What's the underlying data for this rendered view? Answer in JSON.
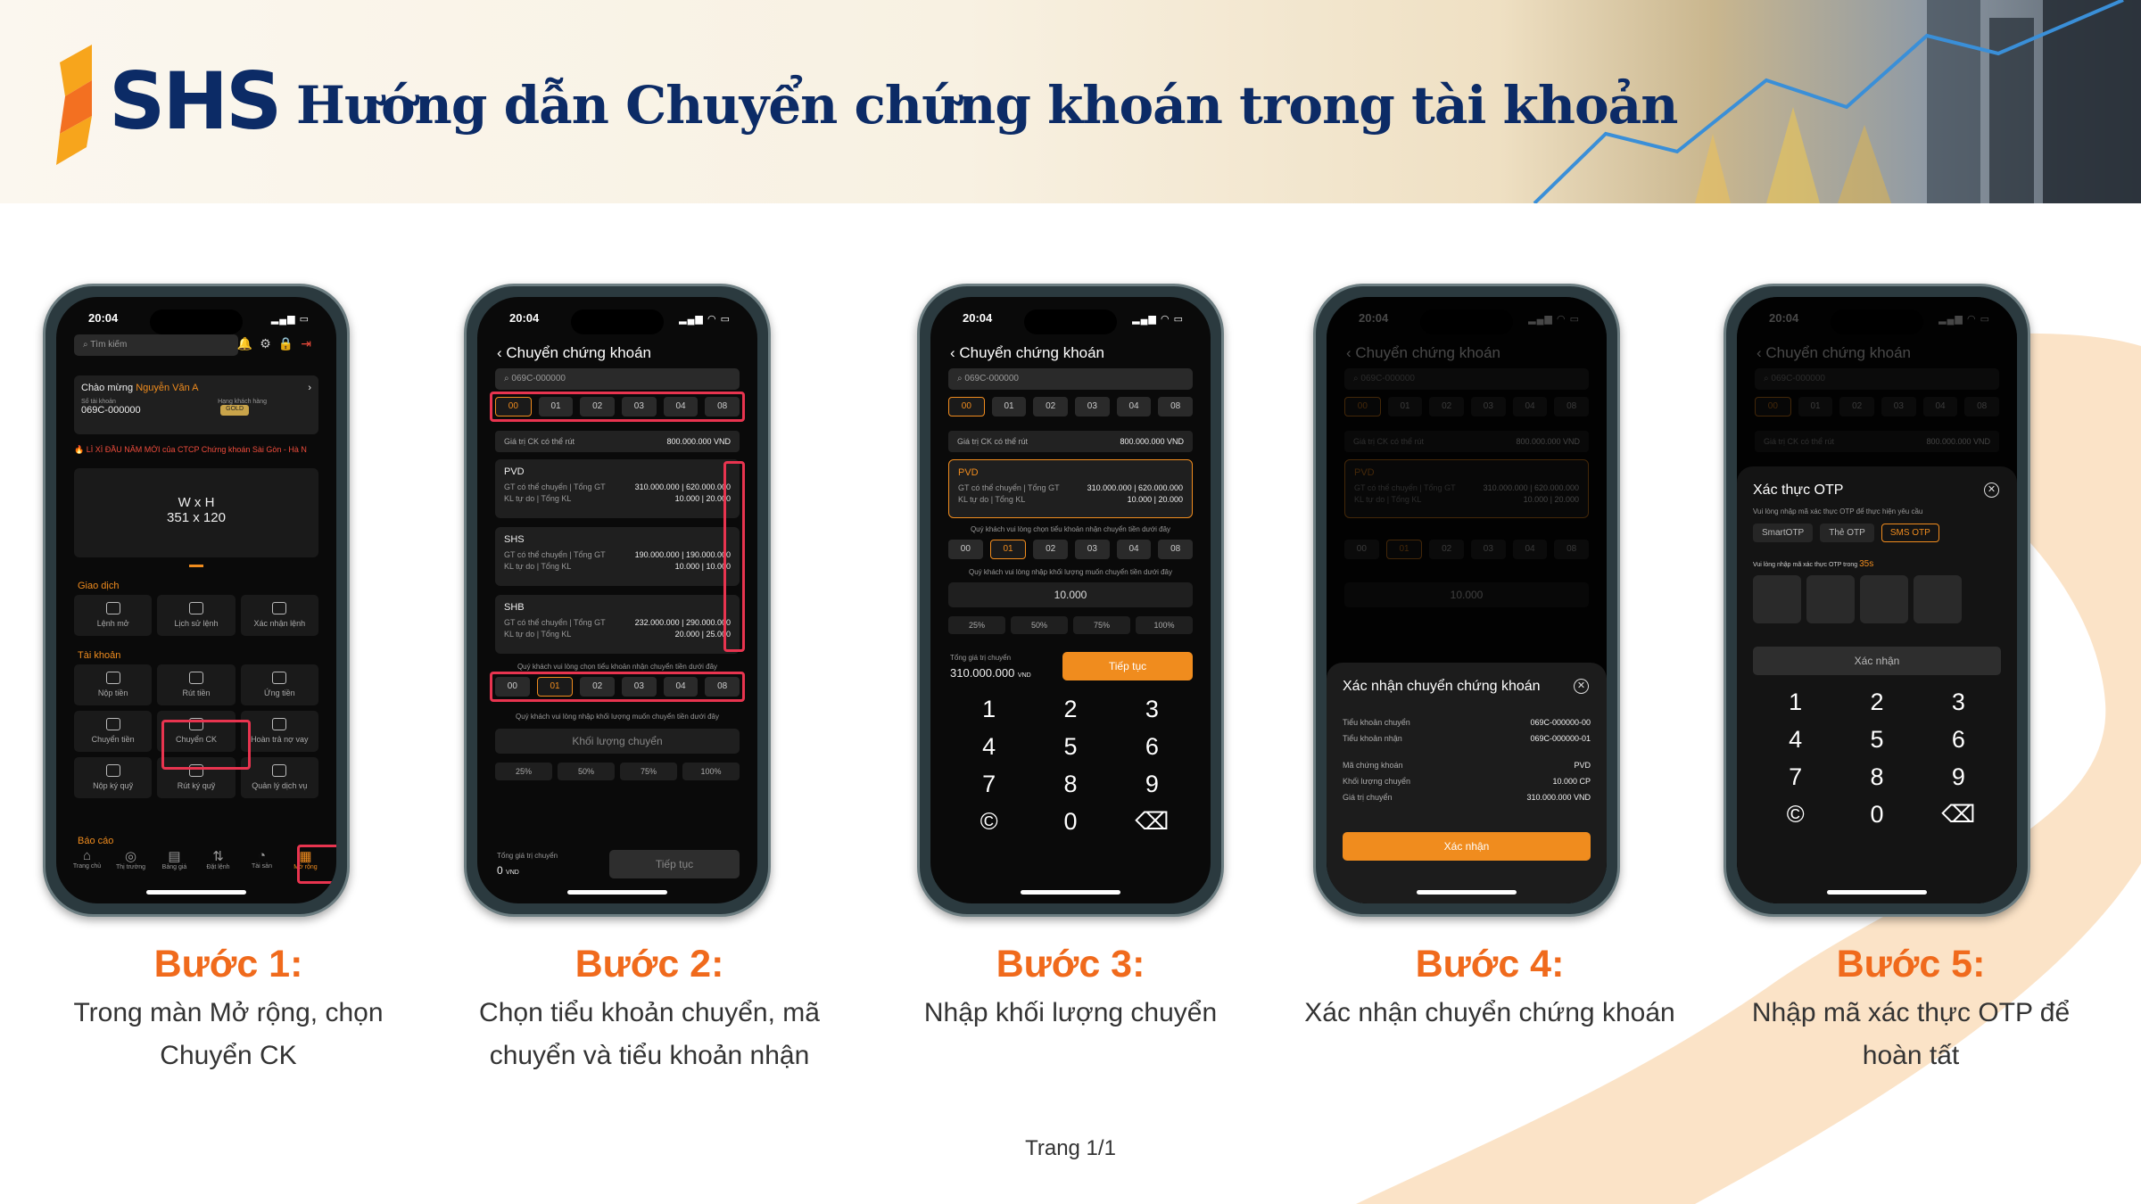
{
  "header": {
    "brand": "SHS",
    "title": "Hướng dẫn Chuyển chứng khoán trong tài khoản"
  },
  "colors": {
    "brand_navy": "#0c2b66",
    "accent_orange": "#f06a1c",
    "app_orange": "#f08c1e",
    "highlight_red": "#e8344f"
  },
  "status_time": "20:04",
  "phone1": {
    "search_placeholder": "Tìm kiếm",
    "greeting": "Chào mừng",
    "user_name": "Nguyễn Văn A",
    "acct_label": "Số tài khoản",
    "acct_no": "069C-000000",
    "tier_label": "Hạng khách hàng",
    "tier": "GOLD",
    "ticker": "LÌ XÌ ĐẦU NĂM MỚI của CTCP Chứng khoán Sài Gòn - Hà N",
    "banner_line1": "W x H",
    "banner_line2": "351 x 120",
    "sec_trade": "Giao dịch",
    "trade_items": [
      "Lệnh mở",
      "Lịch sử lệnh",
      "Xác nhận lệnh"
    ],
    "sec_account": "Tài khoản",
    "account_items": [
      "Nộp tiền",
      "Rút tiền",
      "Ứng tiền",
      "Chuyển tiền",
      "Chuyển CK",
      "Hoàn trả nợ vay",
      "Nộp ký quỹ",
      "Rút ký quỹ",
      "Quản lý dịch vụ"
    ],
    "sec_report": "Báo cáo",
    "bottom_nav": [
      "Trang chủ",
      "Thị trường",
      "Bảng giá",
      "Đặt lệnh",
      "Tài sản",
      "Mở rộng"
    ]
  },
  "transfer": {
    "nav_title": "Chuyển chứng khoán",
    "search_value": "069C-000000",
    "sub_accounts": [
      "00",
      "01",
      "02",
      "03",
      "04",
      "08"
    ],
    "withdraw_label": "Giá trị CK có thể rút",
    "withdraw_value": "800.000.000 VND",
    "line1_label": "GT có thể chuyển | Tổng GT",
    "line2_label": "KL tự do | Tổng KL",
    "stocks": [
      {
        "code": "PVD",
        "v1": "310.000.000 | 620.000.000",
        "v2": "10.000 | 20.000"
      },
      {
        "code": "SHS",
        "v1": "190.000.000 | 190.000.000",
        "v2": "10.000 | 10.000"
      },
      {
        "code": "SHB",
        "v1": "232.000.000 | 290.000.000",
        "v2": "20.000 | 25.000"
      }
    ],
    "recv_note": "Quý khách vui lòng chọn tiểu khoản nhận chuyển tiền dưới đây",
    "qty_note": "Quý khách vui lòng nhập khối lượng muốn chuyển tiền dưới đây",
    "qty_placeholder": "Khối lượng chuyển",
    "qty_value": "10.000",
    "percents": [
      "25%",
      "50%",
      "75%",
      "100%"
    ],
    "total_label": "Tổng giá trị chuyển",
    "total_zero": "0",
    "total_value": "310.000.000",
    "currency": "VND",
    "continue": "Tiếp tục"
  },
  "keypad": {
    "keys": [
      "1",
      "2",
      "3",
      "4",
      "5",
      "6",
      "7",
      "8",
      "9",
      "©",
      "0",
      "⌫"
    ]
  },
  "confirm": {
    "title": "Xác nhận chuyển chứng khoán",
    "rows": [
      {
        "k": "Tiểu khoản chuyển",
        "v": "069C-000000-00"
      },
      {
        "k": "Tiểu khoản nhận",
        "v": "069C-000000-01"
      },
      {
        "k": "Mã chứng khoán",
        "v": "PVD"
      },
      {
        "k": "Khối lượng chuyển",
        "v": "10.000 CP"
      },
      {
        "k": "Giá trị chuyển",
        "v": "310.000.000 VND"
      }
    ],
    "button": "Xác nhận"
  },
  "otp": {
    "title": "Xác thực OTP",
    "subtitle": "Vui lòng nhập mã xác thực OTP để thực hiện yêu cầu",
    "methods": [
      "SmartOTP",
      "Thẻ OTP",
      "SMS OTP"
    ],
    "prompt": "Vui lòng nhập mã xác thực OTP trong",
    "countdown": "35s",
    "button": "Xác nhận"
  },
  "steps": [
    {
      "title": "Bước 1:",
      "desc": "Trong màn Mở rộng, chọn Chuyển CK"
    },
    {
      "title": "Bước 2:",
      "desc": "Chọn tiểu khoản chuyển, mã chuyển và tiểu khoản nhận"
    },
    {
      "title": "Bước 3:",
      "desc": "Nhập khối lượng chuyển"
    },
    {
      "title": "Bước 4:",
      "desc": "Xác nhận chuyển chứng khoán"
    },
    {
      "title": "Bước 5:",
      "desc": "Nhập mã xác thực OTP để hoàn tất"
    }
  ],
  "footer": {
    "page": "Trang 1/1"
  }
}
